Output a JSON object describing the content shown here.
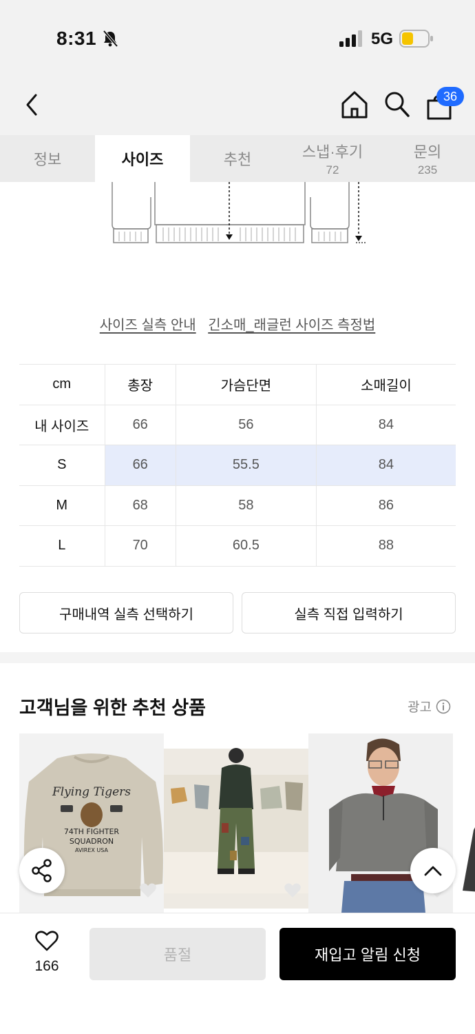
{
  "status_bar": {
    "time": "8:31",
    "network": "5G",
    "battery_color": "#f5c400"
  },
  "header": {
    "cart_count": "36"
  },
  "tabs": [
    {
      "label": "정보",
      "count": ""
    },
    {
      "label": "사이즈",
      "count": ""
    },
    {
      "label": "추천",
      "count": ""
    },
    {
      "label": "스냅·후기",
      "count": "72"
    },
    {
      "label": "문의",
      "count": "235"
    }
  ],
  "size_links": {
    "guide": "사이즈 실측 안내",
    "method": "긴소매_래글런 사이즈 측정법"
  },
  "size_table": {
    "headers": [
      "cm",
      "총장",
      "가슴단면",
      "소매길이"
    ],
    "rows": [
      [
        "내 사이즈",
        "66",
        "56",
        "84"
      ],
      [
        "S",
        "66",
        "55.5",
        "84"
      ],
      [
        "M",
        "68",
        "58",
        "86"
      ],
      [
        "L",
        "70",
        "60.5",
        "88"
      ]
    ],
    "highlight_color": "#e6ecfb"
  },
  "actions": {
    "history_select": "구매내역 실측 선택하기",
    "manual_input": "실측 직접 입력하기"
  },
  "recommend": {
    "title": "고객님을 위한 추천 상품",
    "ad_label": "광고"
  },
  "bottom_bar": {
    "like_count": "166",
    "soldout": "품절",
    "restock_alert": "재입고 알림 신청"
  }
}
